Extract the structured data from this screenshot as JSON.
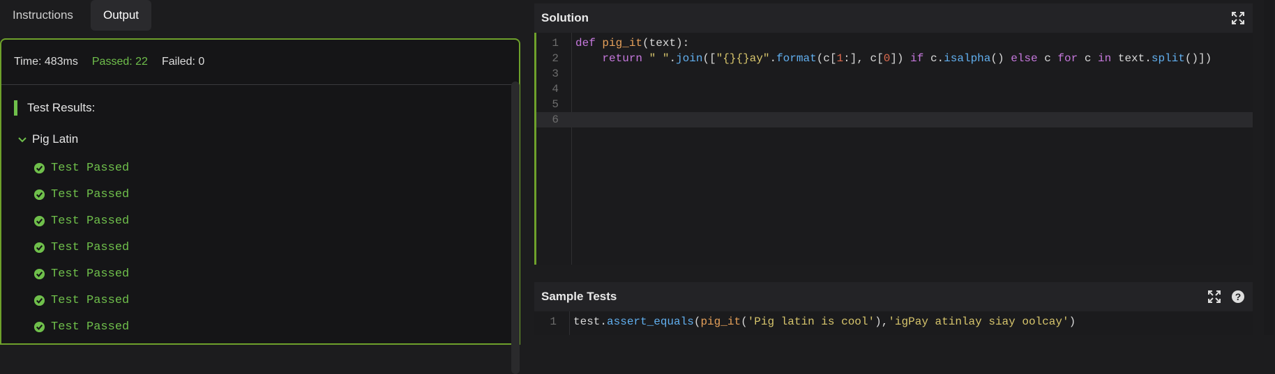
{
  "tabs": [
    {
      "label": "Instructions",
      "active": false
    },
    {
      "label": "Output",
      "active": true
    }
  ],
  "summary": {
    "time": "Time: 483ms",
    "passed": "Passed: 22",
    "failed": "Failed: 0"
  },
  "results": {
    "heading": "Test Results:",
    "group": "Pig Latin",
    "tests": [
      "Test Passed",
      "Test Passed",
      "Test Passed",
      "Test Passed",
      "Test Passed",
      "Test Passed",
      "Test Passed"
    ]
  },
  "solution": {
    "title": "Solution",
    "lines": [
      {
        "n": "1",
        "text": "def pig_it(text):"
      },
      {
        "n": "2",
        "text": "    return \" \".join([\"{}{}ay\".format(c[1:], c[0]) if c.isalpha() else c for c in text.split()])"
      },
      {
        "n": "3",
        "text": ""
      },
      {
        "n": "4",
        "text": ""
      },
      {
        "n": "5",
        "text": ""
      },
      {
        "n": "6",
        "text": ""
      }
    ]
  },
  "sample_tests": {
    "title": "Sample Tests",
    "lines": [
      {
        "n": "1",
        "text": "test.assert_equals(pig_it('Pig latin is cool'),'igPay atinlay siay oolcay')"
      }
    ]
  },
  "icons": [
    "expand-icon",
    "expand-icon",
    "help-icon",
    "check-circle-icon",
    "chevron-down-icon"
  ],
  "colors": {
    "accent": "#6ea12b",
    "pass": "#6fbf4b"
  }
}
